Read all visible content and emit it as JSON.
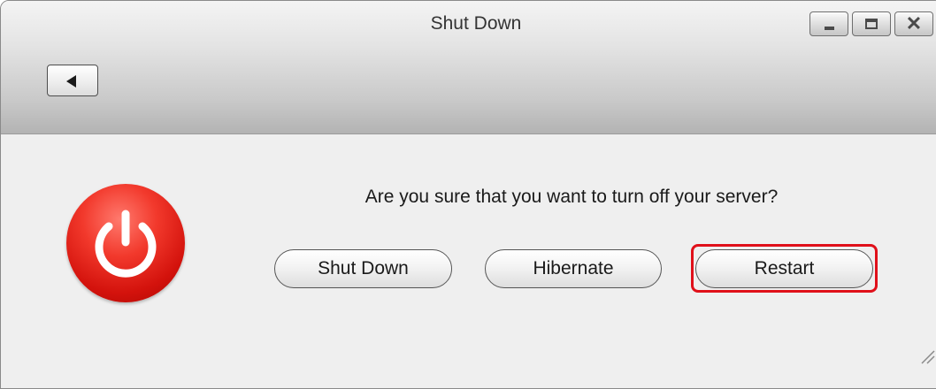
{
  "window": {
    "title": "Shut Down"
  },
  "window_controls": {
    "minimize_icon": "minimize-icon",
    "maximize_icon": "maximize-icon",
    "close_icon": "close-icon",
    "close_glyph": "✕"
  },
  "toolbar": {
    "back_icon": "back-arrow-icon"
  },
  "dialog": {
    "icon": "power-icon",
    "icon_color": "#e8231a",
    "question": "Are you sure that you want to turn off your server?",
    "buttons": {
      "shutdown": "Shut Down",
      "hibernate": "Hibernate",
      "restart": "Restart"
    },
    "highlight_color": "#e0101a"
  }
}
